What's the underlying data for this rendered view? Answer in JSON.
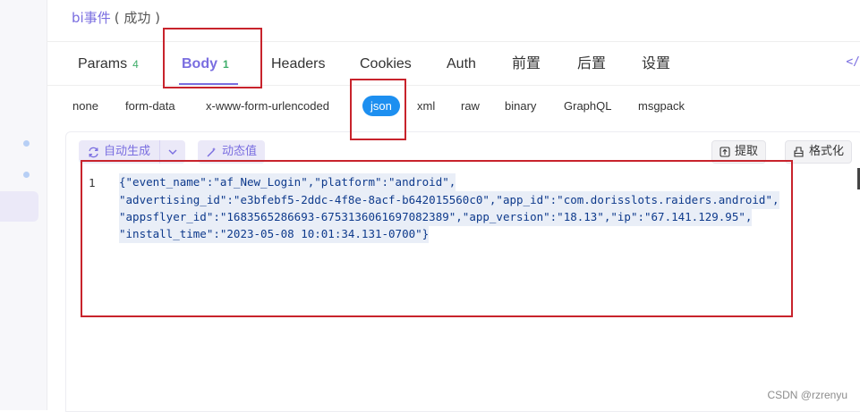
{
  "title": {
    "name": "bi事件",
    "status": "( 成功 )"
  },
  "tabs": [
    {
      "label": "Params",
      "count": "4"
    },
    {
      "label": "Body",
      "count": "1"
    },
    {
      "label": "Headers"
    },
    {
      "label": "Cookies"
    },
    {
      "label": "Auth"
    },
    {
      "label": "前置"
    },
    {
      "label": "后置"
    },
    {
      "label": "设置"
    }
  ],
  "tab_right_icon": "code-icon",
  "body_types": [
    "none",
    "form-data",
    "x-www-form-urlencoded",
    "json",
    "xml",
    "raw",
    "binary",
    "GraphQL",
    "msgpack"
  ],
  "body_type_selected": "json",
  "toolbar": {
    "auto_generate": "自动生成",
    "dynamic_value": "动态值",
    "extract": "提取",
    "format": "格式化"
  },
  "editor": {
    "line_number": "1",
    "lines": [
      "{\"event_name\":\"af_New_Login\",\"platform\":\"android\",",
      "\"advertising_id\":\"e3bfebf5-2ddc-4f8e-8acf-b642015560c0\",\"app_id\":\"com.dorisslots.raiders.android\",",
      "\"appsflyer_id\":\"1683565286693-6753136061697082389\",\"app_version\":\"18.13\",\"ip\":\"67.141.129.95\",",
      "\"install_time\":\"2023-05-08 10:01:34.131-0700\"}"
    ]
  },
  "watermark": "CSDN @rzrenyu",
  "colors": {
    "accent": "#7a6ee0",
    "selected_pill": "#1d8ff0",
    "annotation": "#c8232c",
    "count_green": "#3fae6a"
  }
}
